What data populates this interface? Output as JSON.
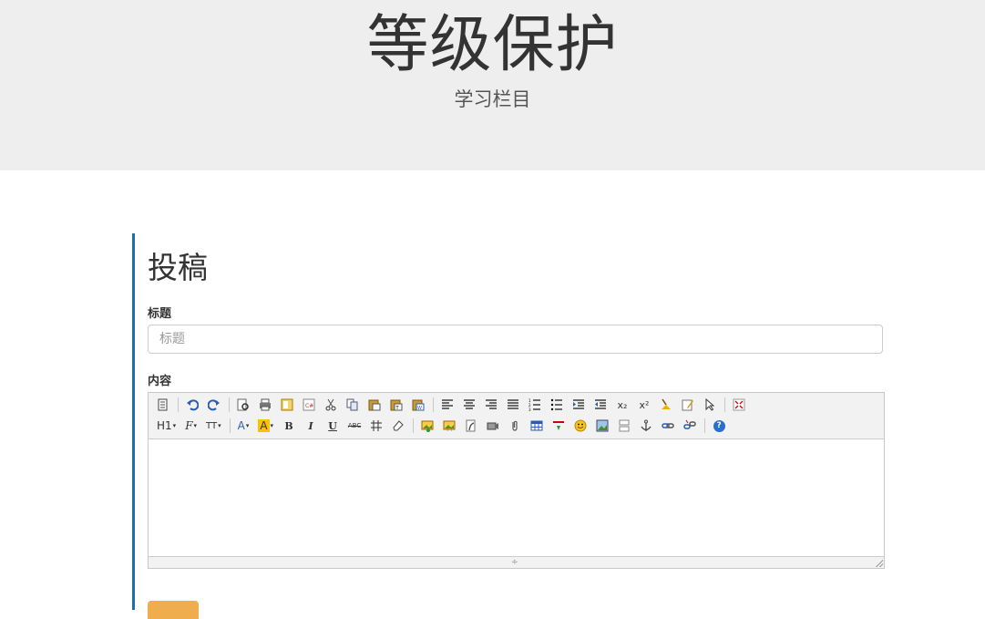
{
  "header": {
    "title": "等级保护",
    "subtitle": "学习栏目"
  },
  "form": {
    "heading": "投稿",
    "title_label": "标题",
    "title_placeholder": "标题",
    "content_label": "内容",
    "submit_label": ""
  },
  "toolbar": {
    "heading_label": "H1",
    "font_label": "F",
    "size_label": "TT",
    "font_color_label": "A",
    "bg_color_label": "A",
    "bold_label": "B",
    "italic_label": "I",
    "underline_label": "U",
    "strike_label": "ABC",
    "subscript_label": "x₂",
    "superscript_label": "x²",
    "help_label": "?"
  },
  "colors": {
    "accent": "#1b6fb5",
    "hero_bg": "#eeeeee",
    "button": "#f0ad4e",
    "highlight": "#f9c300"
  }
}
